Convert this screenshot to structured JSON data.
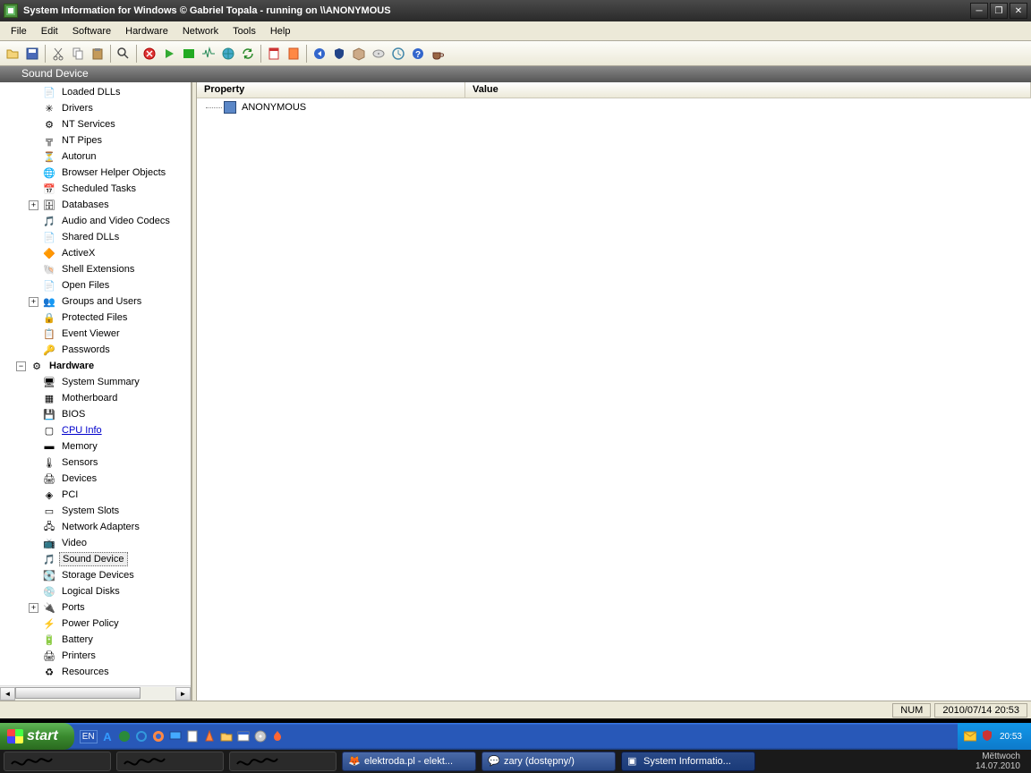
{
  "window": {
    "title": "System Information for Windows  © Gabriel Topala - running on \\\\ANONYMOUS"
  },
  "menu": {
    "file": "File",
    "edit": "Edit",
    "software": "Software",
    "hardware": "Hardware",
    "network": "Network",
    "tools": "Tools",
    "help": "Help"
  },
  "breadcrumb": "Sound Device",
  "tree": {
    "items": [
      {
        "label": "Loaded DLLs",
        "indent": 2,
        "icon": "📄"
      },
      {
        "label": "Drivers",
        "indent": 2,
        "icon": "✳"
      },
      {
        "label": "NT Services",
        "indent": 2,
        "icon": "⚙"
      },
      {
        "label": "NT Pipes",
        "indent": 2,
        "icon": "╦"
      },
      {
        "label": "Autorun",
        "indent": 2,
        "icon": "⏳"
      },
      {
        "label": "Browser Helper Objects",
        "indent": 2,
        "icon": "🌐"
      },
      {
        "label": "Scheduled Tasks",
        "indent": 2,
        "icon": "📅"
      },
      {
        "label": "Databases",
        "indent": 2,
        "icon": "🗄",
        "expander": "+"
      },
      {
        "label": "Audio and Video Codecs",
        "indent": 2,
        "icon": "🎵"
      },
      {
        "label": "Shared DLLs",
        "indent": 2,
        "icon": "📄"
      },
      {
        "label": "ActiveX",
        "indent": 2,
        "icon": "🔶"
      },
      {
        "label": "Shell Extensions",
        "indent": 2,
        "icon": "🐚"
      },
      {
        "label": "Open Files",
        "indent": 2,
        "icon": "📄"
      },
      {
        "label": "Groups and Users",
        "indent": 2,
        "icon": "👥",
        "expander": "+"
      },
      {
        "label": "Protected Files",
        "indent": 2,
        "icon": "🔒"
      },
      {
        "label": "Event Viewer",
        "indent": 2,
        "icon": "📋"
      },
      {
        "label": "Passwords",
        "indent": 2,
        "icon": "🔑"
      },
      {
        "label": "Hardware",
        "indent": 1,
        "icon": "⚙",
        "bold": true,
        "expander": "−"
      },
      {
        "label": "System Summary",
        "indent": 2,
        "icon": "🖥"
      },
      {
        "label": "Motherboard",
        "indent": 2,
        "icon": "▦"
      },
      {
        "label": "BIOS",
        "indent": 2,
        "icon": "💾"
      },
      {
        "label": "CPU Info",
        "indent": 2,
        "icon": "▢",
        "link": true
      },
      {
        "label": "Memory",
        "indent": 2,
        "icon": "▬"
      },
      {
        "label": "Sensors",
        "indent": 2,
        "icon": "🌡"
      },
      {
        "label": "Devices",
        "indent": 2,
        "icon": "🖨"
      },
      {
        "label": "PCI",
        "indent": 2,
        "icon": "◈"
      },
      {
        "label": "System Slots",
        "indent": 2,
        "icon": "▭"
      },
      {
        "label": "Network Adapters",
        "indent": 2,
        "icon": "🖧"
      },
      {
        "label": "Video",
        "indent": 2,
        "icon": "📺"
      },
      {
        "label": "Sound Device",
        "indent": 2,
        "icon": "🎵",
        "selected": true
      },
      {
        "label": "Storage Devices",
        "indent": 2,
        "icon": "💽"
      },
      {
        "label": "Logical Disks",
        "indent": 2,
        "icon": "💿"
      },
      {
        "label": "Ports",
        "indent": 2,
        "icon": "🔌",
        "expander": "+"
      },
      {
        "label": "Power Policy",
        "indent": 2,
        "icon": "⚡"
      },
      {
        "label": "Battery",
        "indent": 2,
        "icon": "🔋"
      },
      {
        "label": "Printers",
        "indent": 2,
        "icon": "🖨"
      },
      {
        "label": "Resources",
        "indent": 2,
        "icon": "♻"
      }
    ]
  },
  "list": {
    "col_property": "Property",
    "col_value": "Value",
    "rows": [
      {
        "property": "ANONYMOUS",
        "value": ""
      }
    ]
  },
  "status": {
    "num": "NUM",
    "datetime": "2010/07/14 20:53"
  },
  "taskbar": {
    "start": "start",
    "quicklaunch_lang": "EN",
    "tasks": [
      {
        "label": "",
        "dark": true
      },
      {
        "label": "",
        "dark": true
      },
      {
        "label": "",
        "dark": true
      },
      {
        "label": "elektroda.pl - elekt...",
        "icon": "🦊"
      },
      {
        "label": "zary (dostępny/)",
        "icon": "💬"
      },
      {
        "label": "System Informatio...",
        "icon": "▣",
        "active": true
      }
    ],
    "tray_time": "20:53",
    "tray2_day": "Mëttwoch",
    "tray2_date": "14.07.2010"
  }
}
